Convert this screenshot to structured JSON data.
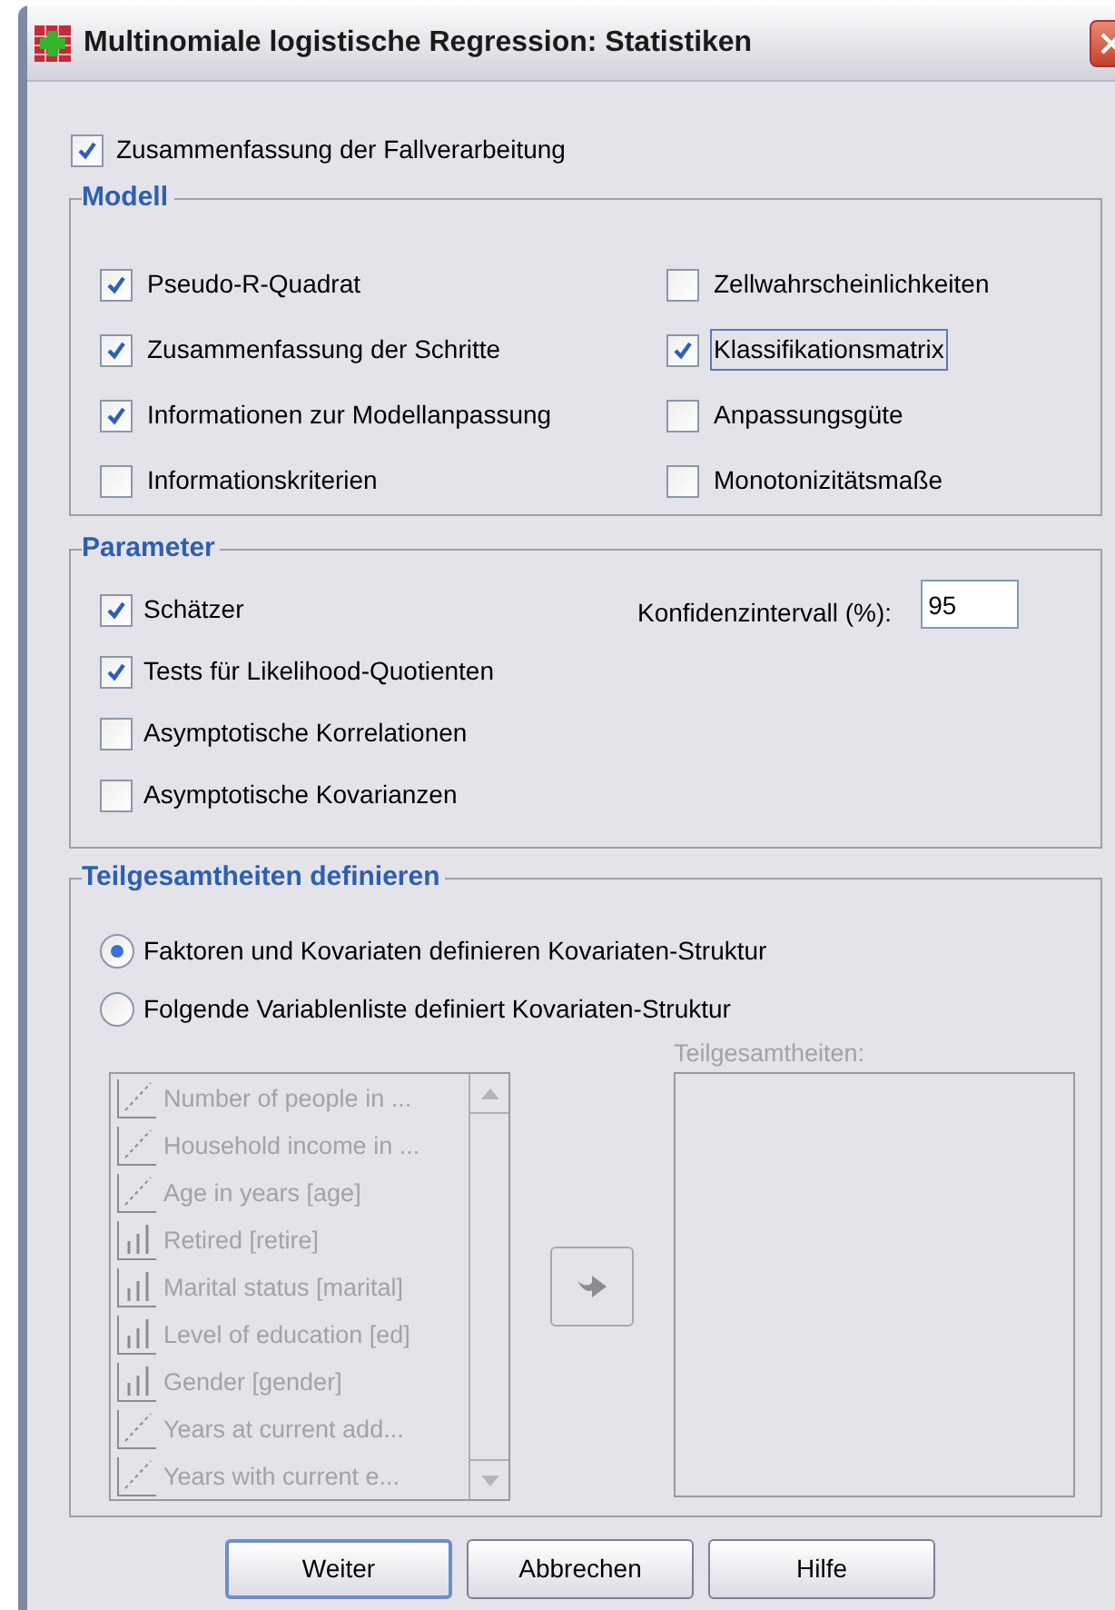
{
  "window": {
    "title": "Multinomiale logistische Regression: Statistiken"
  },
  "case_summary": {
    "label": "Zusammenfassung der Fallverarbeitung",
    "checked": true
  },
  "model": {
    "title": "Modell",
    "options": [
      {
        "label": "Pseudo-R-Quadrat",
        "checked": true,
        "focused": false
      },
      {
        "label": "Zellwahrscheinlichkeiten",
        "checked": false,
        "focused": false
      },
      {
        "label": "Zusammenfassung der Schritte",
        "checked": true,
        "focused": false
      },
      {
        "label": "Klassifikationsmatrix",
        "checked": true,
        "focused": true
      },
      {
        "label": "Informationen zur Modellanpassung",
        "checked": true,
        "focused": false
      },
      {
        "label": "Anpassungsgüte",
        "checked": false,
        "focused": false
      },
      {
        "label": "Informationskriterien",
        "checked": false,
        "focused": false
      },
      {
        "label": "Monotonizitätsmaße",
        "checked": false,
        "focused": false
      }
    ]
  },
  "parameter": {
    "title": "Parameter",
    "options": [
      {
        "label": "Schätzer",
        "checked": true
      },
      {
        "label": "Tests für Likelihood-Quotienten",
        "checked": true
      },
      {
        "label": "Asymptotische Korrelationen",
        "checked": false
      },
      {
        "label": "Asymptotische Kovarianzen",
        "checked": false
      }
    ],
    "confidence_label": "Konfidenzintervall (%):",
    "confidence_value": "95"
  },
  "subpopulations": {
    "title": "Teilgesamtheiten definieren",
    "radios": [
      {
        "label": "Faktoren und Kovariaten definieren Kovariaten-Struktur",
        "selected": true
      },
      {
        "label": "Folgende Variablenliste definiert Kovariaten-Struktur",
        "selected": false
      }
    ],
    "list_disabled": true,
    "variables": [
      {
        "label": "Number of people in ...",
        "kind": "scale"
      },
      {
        "label": "Household income in ...",
        "kind": "scale"
      },
      {
        "label": "Age in years [age]",
        "kind": "scale"
      },
      {
        "label": "Retired [retire]",
        "kind": "nominal"
      },
      {
        "label": "Marital status [marital]",
        "kind": "nominal"
      },
      {
        "label": "Level of education [ed]",
        "kind": "nominal"
      },
      {
        "label": "Gender [gender]",
        "kind": "nominal"
      },
      {
        "label": "Years at current add...",
        "kind": "scale"
      },
      {
        "label": "Years with current e...",
        "kind": "scale"
      }
    ],
    "target_label": "Teilgesamtheiten:"
  },
  "buttons": [
    {
      "label": "Weiter",
      "default": true
    },
    {
      "label": "Abbrechen",
      "default": false
    },
    {
      "label": "Hilfe",
      "default": false
    }
  ]
}
